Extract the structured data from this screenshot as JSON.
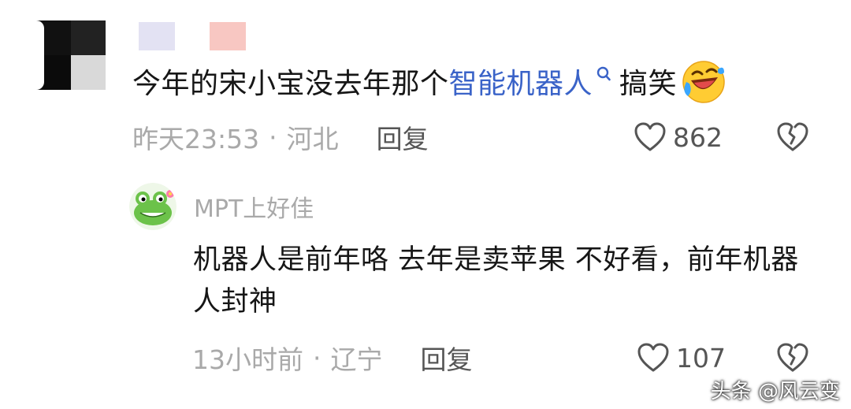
{
  "comment": {
    "text_before_link": "今年的宋小宝没去年那个",
    "link_text": "智能机器人",
    "text_after_link": "搞笑",
    "emoji": "laugh-crying-emoji",
    "time": "昨天23:53",
    "separator": "·",
    "location": "河北",
    "reply_label": "回复",
    "like_count": "862",
    "colors": {
      "link": "#3a63c8",
      "meta": "#a9a9a9",
      "text": "#161616",
      "name_blur_1": "#e3e2f3",
      "name_blur_2": "#f8c7c2"
    }
  },
  "reply": {
    "username": "MPT上好佳",
    "text": "机器人是前年咯 去年是卖苹果 不好看，前年机器人封神",
    "time": "13小时前",
    "separator": "·",
    "location": "辽宁",
    "reply_label": "回复",
    "like_count": "107"
  },
  "watermark": "头条 @风云变"
}
